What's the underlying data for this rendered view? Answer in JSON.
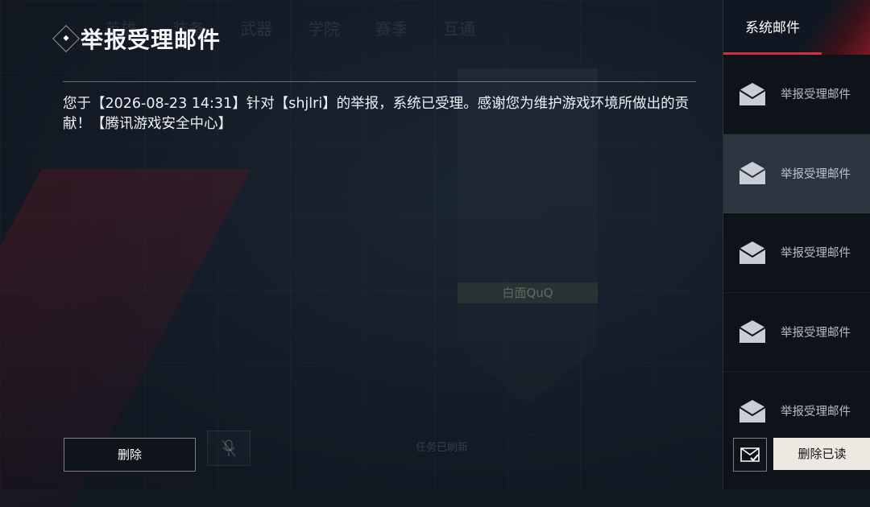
{
  "background": {
    "tabs": [
      "英雄",
      "装备",
      "武器",
      "学院",
      "赛季",
      "互通"
    ],
    "player_name": "白面QuQ",
    "task_status": "任务已刷新"
  },
  "mail": {
    "title": "举报受理邮件",
    "body": "您于【2026-08-23 14:31】针对【shjlri】的举报，系统已受理。感谢您为维护游戏环境所做出的贡献！【腾讯游戏安全中心】",
    "delete_label": "删除"
  },
  "sidebar": {
    "tab_label": "系统邮件",
    "items": [
      {
        "label": "举报受理邮件",
        "selected": false
      },
      {
        "label": "举报受理邮件",
        "selected": true
      },
      {
        "label": "举报受理邮件",
        "selected": false
      },
      {
        "label": "举报受理邮件",
        "selected": false
      },
      {
        "label": "举报受理邮件",
        "selected": false
      }
    ],
    "delete_read_label": "删除已读"
  },
  "colors": {
    "accent_red": "#d1303f",
    "selected_item": "#2c3440",
    "primary_button": "#ece9e2"
  }
}
